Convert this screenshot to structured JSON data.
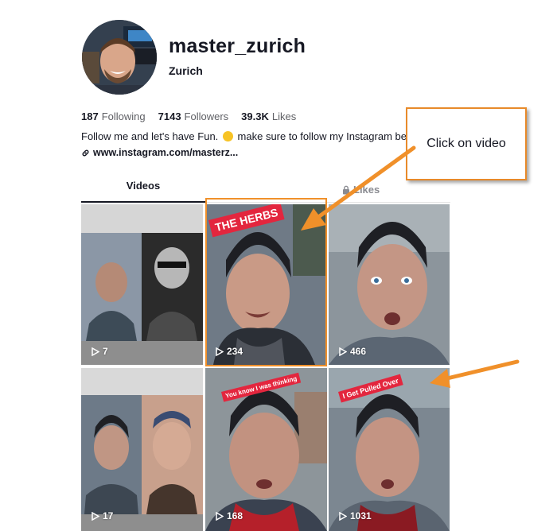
{
  "profile": {
    "username": "master_zurich",
    "nickname": "Zurich",
    "stats": [
      {
        "value": "187",
        "label": "Following"
      },
      {
        "value": "7143",
        "label": "Followers"
      },
      {
        "value": "39.3K",
        "label": "Likes"
      }
    ],
    "bio_before": "Follow me and let's have Fun.",
    "bio_after": "make sure to follow my Instagram below",
    "link": "www.instagram.com/masterz..."
  },
  "tabs": {
    "videos": "Videos",
    "likes": "Likes"
  },
  "videos": [
    {
      "views": "7"
    },
    {
      "views": "234",
      "sticker": "THE HERBS"
    },
    {
      "views": "466"
    },
    {
      "views": "17"
    },
    {
      "views": "168",
      "sticker": "You know I was thinking"
    },
    {
      "views": "1031",
      "sticker": "I Get Pulled Over"
    }
  ],
  "annotation": {
    "callout_text": "Click on video",
    "accent_color": "#f0902a"
  }
}
